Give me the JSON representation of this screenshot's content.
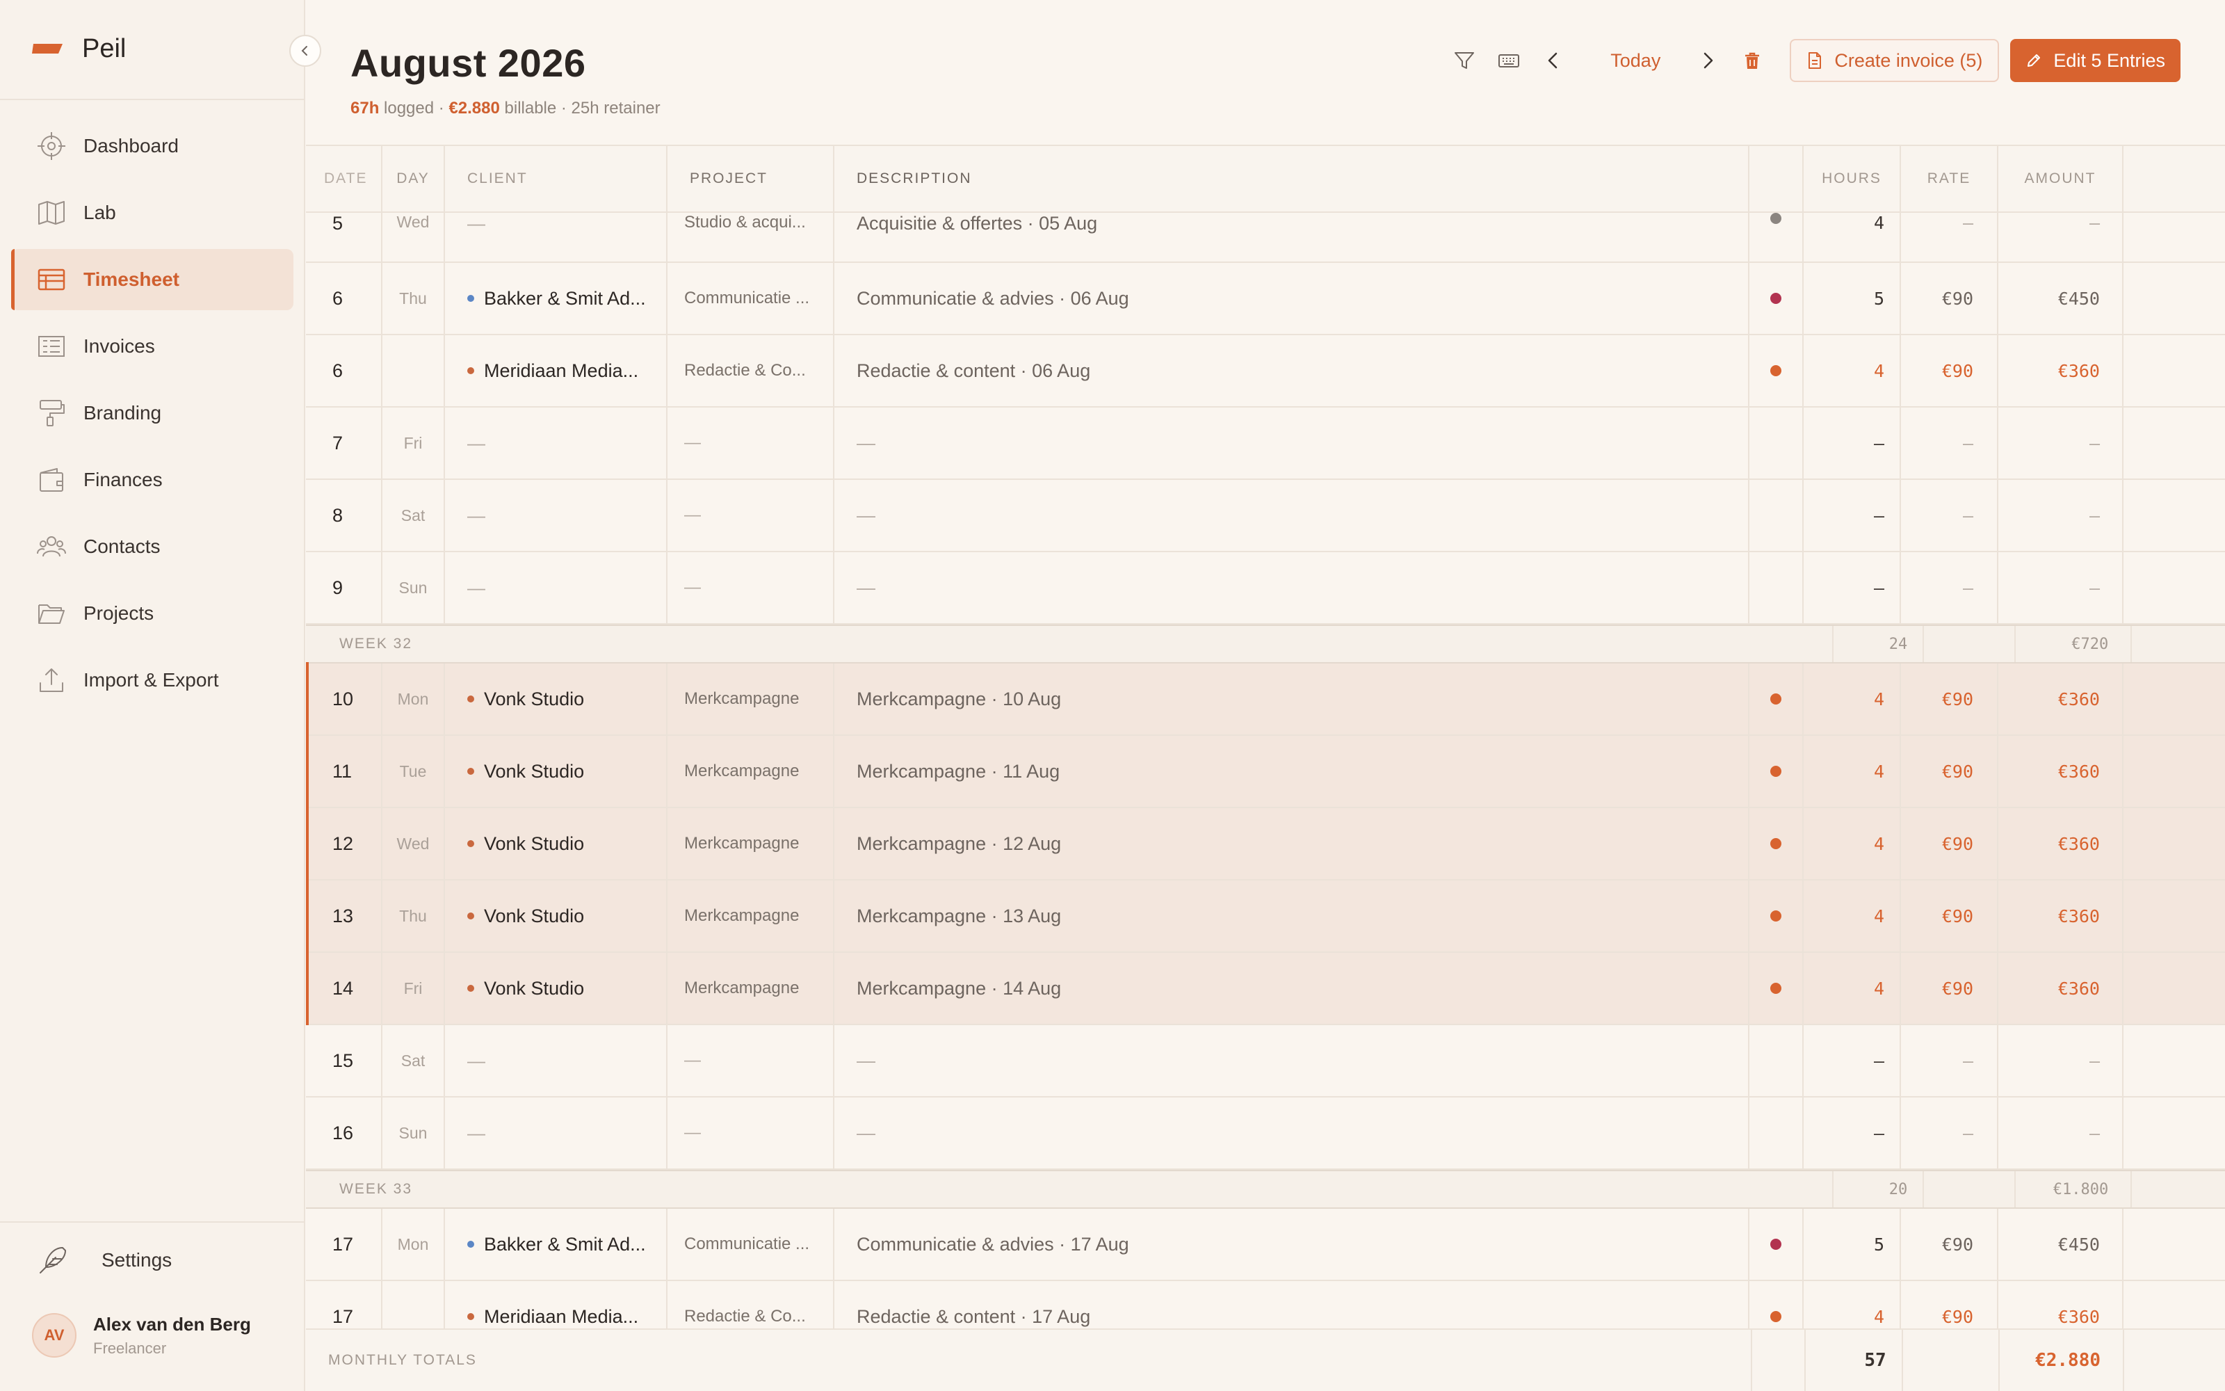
{
  "app": {
    "name": "Peil"
  },
  "nav": [
    {
      "label": "Dashboard",
      "icon": "crosshair-icon"
    },
    {
      "label": "Lab",
      "icon": "map-icon"
    },
    {
      "label": "Timesheet",
      "icon": "table-icon",
      "active": true
    },
    {
      "label": "Invoices",
      "icon": "invoice-list-icon"
    },
    {
      "label": "Branding",
      "icon": "paint-roller-icon"
    },
    {
      "label": "Finances",
      "icon": "wallet-icon"
    },
    {
      "label": "Contacts",
      "icon": "users-icon"
    },
    {
      "label": "Projects",
      "icon": "folder-icon"
    },
    {
      "label": "Import & Export",
      "icon": "upload-icon"
    }
  ],
  "settings": {
    "label": "Settings",
    "icon": "feather-icon"
  },
  "user": {
    "initials": "AV",
    "name": "Alex van den Berg",
    "role": "Freelancer"
  },
  "header": {
    "title": "August 2026",
    "logged": "67h",
    "logged_label": " logged · ",
    "billable": "€2.880",
    "billable_label": " billable · 25h retainer"
  },
  "toolbar": {
    "today": "Today",
    "create_invoice": "Create invoice (5)",
    "edit_entries": "Edit 5 Entries"
  },
  "columns": {
    "date": "DATE",
    "day": "DAY",
    "client": "CLIENT",
    "project": "PROJECT",
    "description": "DESCRIPTION",
    "hours": "HOURS",
    "rate": "RATE",
    "amount": "AMOUNT"
  },
  "colors": {
    "accent": "#d8632f",
    "blue_client": "#5b86c5",
    "orange_client": "#c9683e",
    "status_gray": "#8b8580",
    "status_red": "#b23350",
    "status_orange": "#d8632f"
  },
  "rows": [
    {
      "type": "entry",
      "date": "5",
      "day": "Wed",
      "client": "—",
      "project": "Studio & acqui...",
      "description": "Acquisitie & offertes · 05 Aug",
      "status": "gray",
      "hours": "4",
      "rate": "–",
      "amount": "–",
      "first": true
    },
    {
      "type": "entry",
      "date": "6",
      "day": "Thu",
      "client": "Bakker & Smit Ad...",
      "client_color": "blue",
      "project": "Communicatie ...",
      "description": "Communicatie & advies · 06 Aug",
      "status": "red",
      "hours": "5",
      "rate": "€90",
      "amount": "€450"
    },
    {
      "type": "entry",
      "date": "6",
      "day": "",
      "client": "Meridiaan Media...",
      "client_color": "orange",
      "project": "Redactie & Co...",
      "description": "Redactie & content · 06 Aug",
      "status": "orange",
      "hours": "4",
      "rate": "€90",
      "amount": "€360",
      "accent": true
    },
    {
      "type": "entry",
      "date": "7",
      "day": "Fri",
      "client": "—",
      "project": "—",
      "description": "—",
      "hours": "–",
      "rate": "–",
      "amount": "–",
      "empty": true
    },
    {
      "type": "entry",
      "date": "8",
      "day": "Sat",
      "client": "—",
      "project": "—",
      "description": "—",
      "hours": "–",
      "rate": "–",
      "amount": "–",
      "empty": true
    },
    {
      "type": "entry",
      "date": "9",
      "day": "Sun",
      "client": "—",
      "project": "—",
      "description": "—",
      "hours": "–",
      "rate": "–",
      "amount": "–",
      "empty": true
    },
    {
      "type": "week",
      "label": "WEEK 32",
      "hours": "24",
      "amount": "€720"
    },
    {
      "type": "entry",
      "date": "10",
      "day": "Mon",
      "client": "Vonk Studio",
      "client_color": "orange",
      "project": "Merkcampagne",
      "description": "Merkcampagne · 10 Aug",
      "status": "orange",
      "hours": "4",
      "rate": "€90",
      "amount": "€360",
      "accent": true,
      "selected": true
    },
    {
      "type": "entry",
      "date": "11",
      "day": "Tue",
      "client": "Vonk Studio",
      "client_color": "orange",
      "project": "Merkcampagne",
      "description": "Merkcampagne · 11 Aug",
      "status": "orange",
      "hours": "4",
      "rate": "€90",
      "amount": "€360",
      "accent": true,
      "selected": true
    },
    {
      "type": "entry",
      "date": "12",
      "day": "Wed",
      "client": "Vonk Studio",
      "client_color": "orange",
      "project": "Merkcampagne",
      "description": "Merkcampagne · 12 Aug",
      "status": "orange",
      "hours": "4",
      "rate": "€90",
      "amount": "€360",
      "accent": true,
      "selected": true
    },
    {
      "type": "entry",
      "date": "13",
      "day": "Thu",
      "client": "Vonk Studio",
      "client_color": "orange",
      "project": "Merkcampagne",
      "description": "Merkcampagne · 13 Aug",
      "status": "orange",
      "hours": "4",
      "rate": "€90",
      "amount": "€360",
      "accent": true,
      "selected": true
    },
    {
      "type": "entry",
      "date": "14",
      "day": "Fri",
      "client": "Vonk Studio",
      "client_color": "orange",
      "project": "Merkcampagne",
      "description": "Merkcampagne · 14 Aug",
      "status": "orange",
      "hours": "4",
      "rate": "€90",
      "amount": "€360",
      "accent": true,
      "selected": true
    },
    {
      "type": "entry",
      "date": "15",
      "day": "Sat",
      "client": "—",
      "project": "—",
      "description": "—",
      "hours": "–",
      "rate": "–",
      "amount": "–",
      "empty": true
    },
    {
      "type": "entry",
      "date": "16",
      "day": "Sun",
      "client": "—",
      "project": "—",
      "description": "—",
      "hours": "–",
      "rate": "–",
      "amount": "–",
      "empty": true
    },
    {
      "type": "week",
      "label": "WEEK 33",
      "hours": "20",
      "amount": "€1.800"
    },
    {
      "type": "entry",
      "date": "17",
      "day": "Mon",
      "client": "Bakker & Smit Ad...",
      "client_color": "blue",
      "project": "Communicatie ...",
      "description": "Communicatie & advies · 17 Aug",
      "status": "red",
      "hours": "5",
      "rate": "€90",
      "amount": "€450"
    },
    {
      "type": "entry",
      "date": "17",
      "day": "",
      "client": "Meridiaan Media...",
      "client_color": "orange",
      "project": "Redactie & Co...",
      "description": "Redactie & content · 17 Aug",
      "status": "orange",
      "hours": "4",
      "rate": "€90",
      "amount": "€360",
      "accent": true
    }
  ],
  "totals": {
    "label": "MONTHLY TOTALS",
    "hours": "57",
    "amount": "€2.880"
  }
}
